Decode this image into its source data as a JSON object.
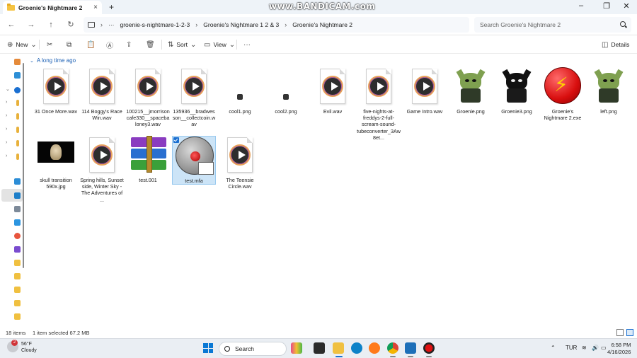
{
  "window": {
    "tab_title": "Groenie's Nightmare 2",
    "tab_close": "×",
    "new_tab": "+",
    "watermark": "www.BANDICAM.com",
    "minimize": "–",
    "maximize": "❐",
    "close": "✕"
  },
  "address": {
    "back": "←",
    "forward": "→",
    "up": "↑",
    "refresh": "↻",
    "more": "···",
    "breadcrumbs": [
      "groenie-s-nightmare-1-2-3",
      "Groenie's Nightmare 1 2 & 3",
      "Groenie's Nightmare 2"
    ],
    "sep": "›",
    "search_placeholder": "Search Groenie's Nightmare 2"
  },
  "commands": {
    "new": "New",
    "sort": "Sort",
    "view": "View",
    "more": "···",
    "details": "Details",
    "new_glyph": "⊕",
    "cut_glyph": "✂",
    "copy_glyph": "⧉",
    "paste_glyph": "📋",
    "rename_glyph": "Ⓐ",
    "share_glyph": "⇪",
    "delete_glyph": "🗑",
    "sort_glyph": "⇅",
    "view_glyph": "▭",
    "details_glyph": "◫",
    "caret": "⌄"
  },
  "group": {
    "label": "A long time ago",
    "chevron": "⌄"
  },
  "files": [
    {
      "name": "31 Once More.wav",
      "kind": "wav"
    },
    {
      "name": "114 Boggy's Race Win.wav",
      "kind": "wav"
    },
    {
      "name": "100215__jmorrisoncafe330__spacebaloney3.wav",
      "kind": "wav"
    },
    {
      "name": "135936__bradwesson__collectcoin.wav",
      "kind": "wav"
    },
    {
      "name": "cool1.png",
      "kind": "tiny"
    },
    {
      "name": "cool2.png",
      "kind": "tiny"
    },
    {
      "name": "Evil.wav",
      "kind": "wav"
    },
    {
      "name": "five-nights-at-freddys-2-full-scream-sound-tubeconverter_3Aw8et...",
      "kind": "wav"
    },
    {
      "name": "Game Intro.wav",
      "kind": "wav"
    },
    {
      "name": "Groenie.png",
      "kind": "goblin"
    },
    {
      "name": "Groenie3.png",
      "kind": "goblin-dark"
    },
    {
      "name": "Groenie's Nightmare 2.exe",
      "kind": "exe"
    },
    {
      "name": "left.png",
      "kind": "goblin"
    },
    {
      "name": "skull transition 590x.jpg",
      "kind": "skull"
    },
    {
      "name": "Spring hills, Sunset side, Winter Sky - The Adventures of ...",
      "kind": "wav"
    },
    {
      "name": "test.001",
      "kind": "rar"
    },
    {
      "name": "test.mfa",
      "kind": "mfa",
      "selected": true
    },
    {
      "name": "The Teensie Circle.wav",
      "kind": "wav"
    }
  ],
  "status": {
    "item_count": "18 items",
    "selection": "1 item selected  67.2 MB"
  },
  "taskbar": {
    "weather_badge": "2",
    "temperature": "56°F",
    "condition": "Cloudy",
    "search_label": "Search",
    "language": "TUR",
    "time": "6:58 PM",
    "date": "4/16/2026",
    "tray_up": "⌃",
    "wifi": "≋",
    "sound": "🔊",
    "battery": "▭"
  }
}
